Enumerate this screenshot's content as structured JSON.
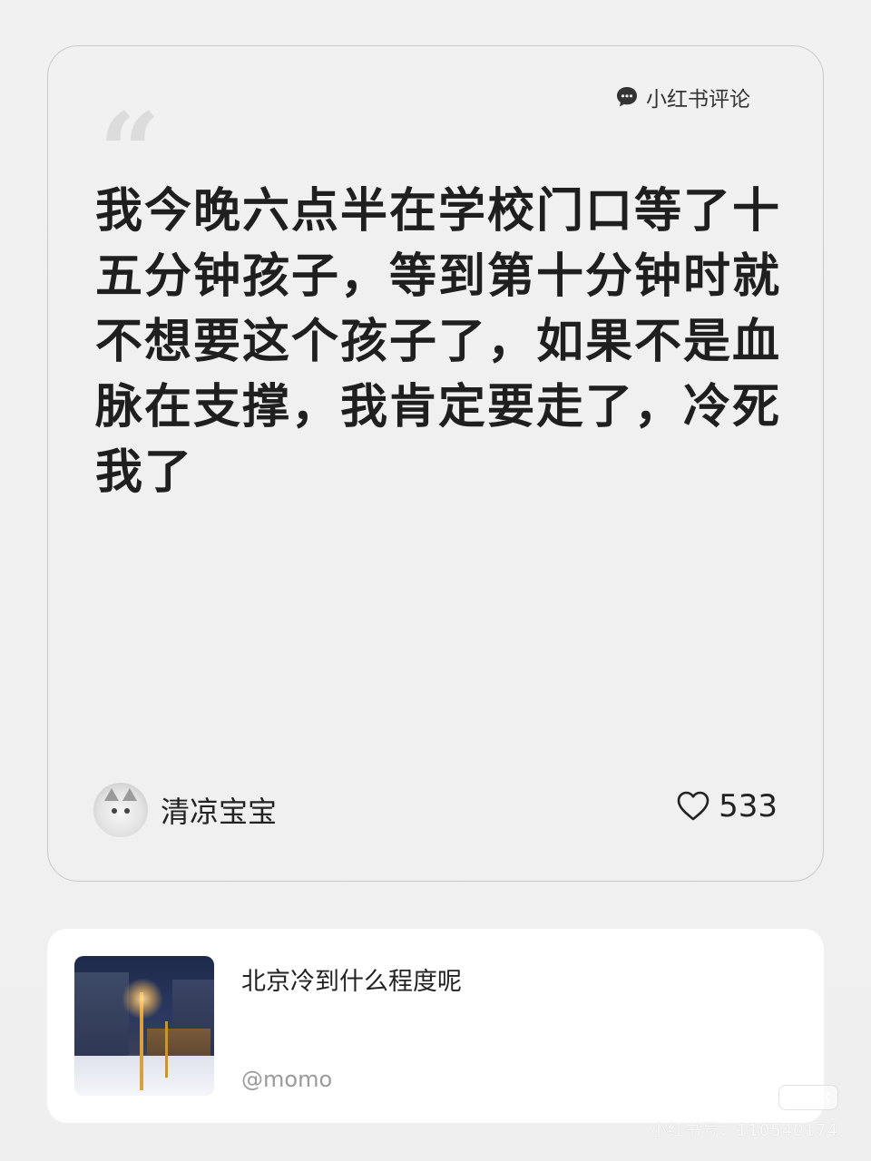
{
  "source_tag": {
    "icon": "chat-bubble-icon",
    "label": "小红书评论"
  },
  "comment": {
    "quote_mark": "“",
    "text": "我今晚六点半在学校门口等了十五分钟孩子，等到第十分钟时就不想要这个孩子了，如果不是血脉在支撑，我肯定要走了，冷死我了",
    "author": "清凉宝宝",
    "avatar": "cat-avatar",
    "likes": "533",
    "like_icon": "heart-outline-icon"
  },
  "post": {
    "title": "北京冷到什么程度呢",
    "author": "@momo",
    "thumbnail": "snowy-night-street-lamp"
  },
  "watermark": {
    "logo": "小红书",
    "id": "小红书号：110540174"
  }
}
